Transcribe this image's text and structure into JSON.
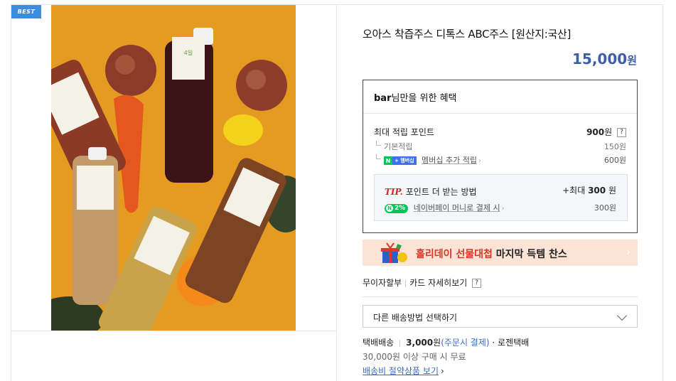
{
  "badge": "BEST",
  "product": {
    "title": "오아스 착즙주스 디톡스 ABC주스 [원산지:국산]",
    "price": "15,000",
    "currency": "원"
  },
  "benefit": {
    "user": "bar",
    "title_suffix": "님만을 위한 혜택",
    "max_points_label": "최대 적립 포인트",
    "max_points_value": "900",
    "max_points_unit": "원",
    "help": "?",
    "basic_label": "기본적립",
    "basic_value": "150원",
    "membership_badge_n": "N",
    "membership_badge_plus": "+ 멤버십",
    "membership_label": "멤버십 추가 적립",
    "membership_value": "600원",
    "tip_mark": "TIP.",
    "tip_label": "포인트 더 받는 방법",
    "tip_value_prefix": "+최대",
    "tip_value": "300",
    "tip_unit": "원",
    "pay_pct": "2%",
    "pay_label": "네이버페이 머니로 결제 시",
    "pay_value": "300원"
  },
  "banner": {
    "red_text": "홀리데이 선물대첩",
    "text": "마지막 득템 찬스",
    "arrow": "›"
  },
  "links": {
    "installment": "무이자할부",
    "card_detail": "카드 자세히보기",
    "help": "?"
  },
  "shipping": {
    "select_label": "다른 배송방법 선택하기",
    "method": "택배배송",
    "fee": "3,000",
    "fee_unit": "원",
    "fee_note": "(주문시 결제)",
    "carrier": "· 로젠택배",
    "free_condition": "30,000원 이상 구매 시 무료",
    "save_link": "배송비 절약상품 보기"
  },
  "colors": {
    "price": "#3e5fa8",
    "badge": "#3c8ce0",
    "naver_green": "#03c75a",
    "tip_red": "#d32626",
    "banner_bg": "#fbe4d6"
  },
  "icons": {
    "product_photo": "juice-bottles-photo",
    "banner_gift": "gift-box-icon",
    "select_arrow": "chevron-down-icon"
  }
}
